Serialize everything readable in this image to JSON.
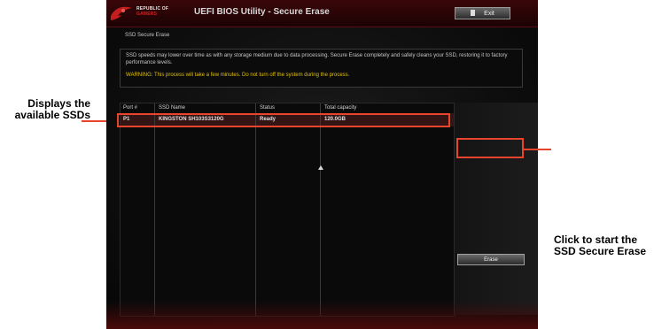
{
  "header": {
    "brand_line1": "REPUBLIC OF",
    "brand_line2": "GAMERS",
    "title": "UEFI BIOS Utility - Secure Erase",
    "exit_label": "Exit"
  },
  "breadcrumb": "SSD Secure Erase",
  "info": {
    "description": "SSD speeds may lower over time as with any storage medium due to data processing. Secure Erase completely and safely cleans your SSD, restoring it to factory performance levels.",
    "warning": "WARNING: This process will take a few minutes. Do not turn off the system during the process."
  },
  "table": {
    "headers": [
      "Port #",
      "SSD Name",
      "Status",
      "Total capacity"
    ],
    "rows": [
      {
        "port": "P1",
        "name": "KINGSTON SH103S3120G",
        "status": "Ready",
        "capacity": "120.0GB"
      }
    ]
  },
  "erase_label": "Erase",
  "callouts": {
    "left": "Displays the available SSDs",
    "right": "Click to start the SSD Secure Erase"
  },
  "colors": {
    "annotation_red": "#e8452c",
    "warning_yellow": "#e6c200",
    "header_red": "#3a0608"
  }
}
